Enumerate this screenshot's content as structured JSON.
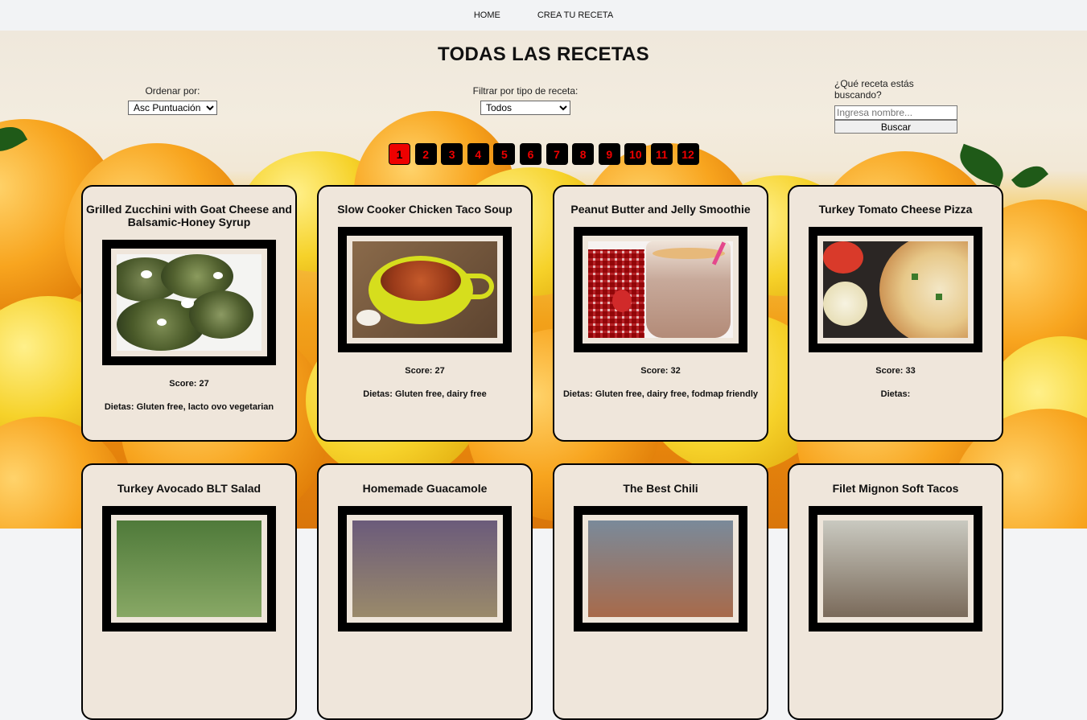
{
  "nav": {
    "home": "HOME",
    "create": "CREA TU RECETA"
  },
  "title": "TODAS LAS RECETAS",
  "sort": {
    "label": "Ordenar por:",
    "selected": "Asc Puntuación"
  },
  "filter": {
    "label": "Filtrar por tipo de receta:",
    "selected": "Todos"
  },
  "search": {
    "label": "¿Qué receta estás buscando?",
    "placeholder": "Ingresa nombre...",
    "button": "Buscar"
  },
  "pagination": {
    "pages": [
      "1",
      "2",
      "3",
      "4",
      "5",
      "6",
      "7",
      "8",
      "9",
      "10",
      "11",
      "12"
    ],
    "active": "1"
  },
  "recipes": [
    {
      "name": "Grilled Zucchini with Goat Cheese and Balsamic-Honey Syrup",
      "score": "Score: 27",
      "diets": "Dietas: Gluten free, lacto ovo vegetarian"
    },
    {
      "name": "Slow Cooker Chicken Taco Soup",
      "score": "Score: 27",
      "diets": "Dietas: Gluten free, dairy free"
    },
    {
      "name": "Peanut Butter and Jelly Smoothie",
      "score": "Score: 32",
      "diets": "Dietas: Gluten free, dairy free, fodmap friendly"
    },
    {
      "name": "Turkey Tomato Cheese Pizza",
      "score": "Score: 33",
      "diets": "Dietas:"
    },
    {
      "name": "Turkey Avocado BLT Salad"
    },
    {
      "name": "Homemade Guacamole"
    },
    {
      "name": "The Best Chili"
    },
    {
      "name": "Filet Mignon Soft Tacos"
    }
  ],
  "colors": {
    "active_page": "#ee0000",
    "page_text": "#ee0000",
    "card_bg": "#efe6db"
  }
}
